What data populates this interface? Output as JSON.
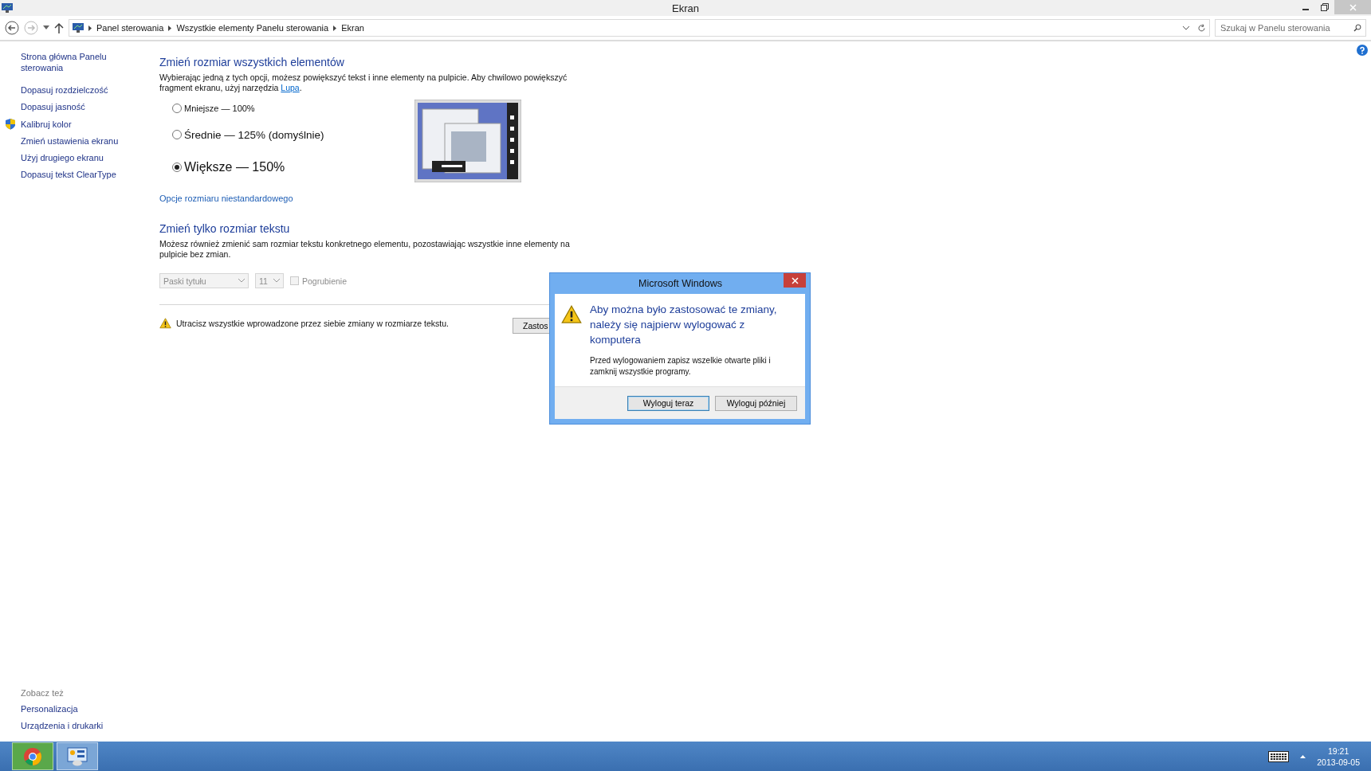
{
  "window": {
    "title": "Ekran"
  },
  "address_bar": {
    "breadcrumbs": [
      "Panel sterowania",
      "Wszystkie elementy Panelu sterowania",
      "Ekran"
    ]
  },
  "search": {
    "placeholder": "Szukaj w Panelu sterowania"
  },
  "sidebar": {
    "items": [
      {
        "label": "Strona główna Panelu sterowania",
        "kind": "link"
      },
      {
        "label": "Dopasuj rozdzielczość",
        "kind": "link"
      },
      {
        "label": "Dopasuj jasność",
        "kind": "link"
      },
      {
        "label": "Kalibruj kolor",
        "kind": "shield"
      },
      {
        "label": "Zmień ustawienia ekranu",
        "kind": "link"
      },
      {
        "label": "Użyj drugiego ekranu",
        "kind": "link"
      },
      {
        "label": "Dopasuj tekst ClearType",
        "kind": "link"
      }
    ],
    "see_also": {
      "title": "Zobacz też",
      "items": [
        "Personalizacja",
        "Urządzenia i drukarki"
      ]
    }
  },
  "scale_section": {
    "title": "Zmień rozmiar wszystkich elementów",
    "description": "Wybierając jedną z tych opcji, możesz powiększyć tekst i inne elementy na pulpicie. Aby chwilowo powiększyć fragment ekranu, użyj narzędzia ",
    "link": "Lupa",
    "description_end": ".",
    "options": [
      {
        "label": "Mniejsze — 100%",
        "kind": "small",
        "selected": false
      },
      {
        "label": "Średnie — 125% (domyślnie)",
        "kind": "medium",
        "selected": false
      },
      {
        "label": "Większe — 150%",
        "kind": "large",
        "selected": true
      }
    ],
    "custom_link": "Opcje rozmiaru niestandardowego"
  },
  "text_section": {
    "title": "Zmień tylko rozmiar tekstu",
    "description": "Możesz również zmienić sam rozmiar tekstu konkretnego elementu, pozostawiając wszystkie inne elementy na pulpicie bez zmian.",
    "element_select": {
      "value": "Paski tytułu",
      "disabled": true
    },
    "size_select": {
      "value": "11",
      "disabled": true
    },
    "bold_checkbox": {
      "label": "Pogrubienie",
      "checked": false,
      "disabled": true
    },
    "warning": "Utracisz wszystkie wprowadzone przez siebie zmiany w rozmiarze tekstu.",
    "apply_button": "Zastos"
  },
  "dialog": {
    "title": "Microsoft Windows",
    "heading": "Aby można było zastosować te zmiany, należy się najpierw wylogować z komputera",
    "message": "Przed wylogowaniem zapisz wszelkie otwarte pliki i zamknij wszystkie programy.",
    "buttons": [
      {
        "label": "Wyloguj teraz",
        "selected": true
      },
      {
        "label": "Wyloguj później",
        "selected": false
      }
    ]
  },
  "taskbar": {
    "time": "19:21",
    "date": "2013-09-05"
  }
}
